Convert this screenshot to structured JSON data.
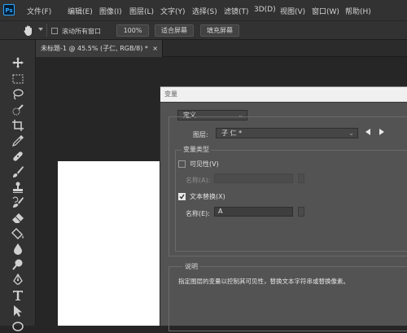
{
  "app": {
    "logo_text": "Ps"
  },
  "menubar": {
    "items": [
      "文件(F)",
      "编辑(E)",
      "图像(I)",
      "图层(L)",
      "文字(Y)",
      "选择(S)",
      "滤镜(T)",
      "3D(D)",
      "视图(V)",
      "窗口(W)",
      "帮助(H)"
    ]
  },
  "options_bar": {
    "scroll_all_label": "滚动所有窗口",
    "scroll_all_checked": false,
    "zoom_100": "100%",
    "fit_screen": "适合屏幕",
    "fill_screen": "填充屏幕"
  },
  "document_tab": {
    "title": "未标题-1 @ 45.5% (子仁, RGB/8) *",
    "close": "×"
  },
  "dialog": {
    "title": "变量",
    "define_select": "定义",
    "layer_label": "图层:",
    "layer_value": "子 仁 *",
    "var_type_header": "变量类型",
    "visibility_label": "可见性(V)",
    "visibility_checked": false,
    "visibility_name_label": "名称(A):",
    "visibility_name_value": "",
    "text_replace_label": "文本替换(X)",
    "text_replace_checked": true,
    "text_name_label": "名称(E):",
    "text_name_value": "A",
    "desc_header": "说明",
    "desc_text": "指定图层的变量以控制其可见性，替换文本字符串或替换像素。"
  },
  "colors": {
    "menubar_bg": "#323232",
    "canvas_bg": "#262626",
    "dialog_bg": "#535353",
    "accent_blue": "#31a8ff"
  },
  "icons": {
    "toolbar": [
      "move-icon",
      "marquee-icon",
      "lasso-icon",
      "quick-select-icon",
      "crop-icon",
      "eyedropper-icon",
      "healing-icon",
      "brush-icon",
      "stamp-icon",
      "history-brush-icon",
      "eraser-icon",
      "paint-bucket-icon",
      "blur-icon",
      "dodge-icon",
      "pen-icon",
      "type-icon",
      "path-select-icon",
      "ellipse-icon"
    ]
  }
}
